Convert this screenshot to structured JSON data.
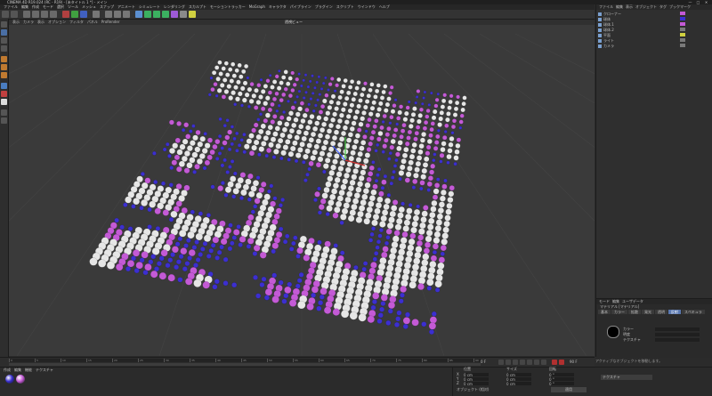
{
  "window": {
    "title": "CINEMA 4D R19.024 (RC - R19) - [未タイトル 1 *] - メイン",
    "controls": [
      "—",
      "□",
      "✕"
    ]
  },
  "menubar": {
    "items": [
      "ファイル",
      "編集",
      "作成",
      "モード",
      "選択",
      "ツール",
      "メッシュ",
      "スナップ",
      "アニメート",
      "シミュレート",
      "レンダリング",
      "スカルプト",
      "モーショントラッカー",
      "MoGraph",
      "キャラクタ",
      "パイプライン",
      "プラグイン",
      "スクリプト",
      "ウインドウ",
      "ヘルプ"
    ]
  },
  "viewport": {
    "menu": [
      "表示",
      "カメラ",
      "表示",
      "オプション",
      "フィルタ",
      "パネル",
      "ProRender"
    ],
    "title": "透視ビュー",
    "colors": {
      "white": "#e6e6e6",
      "violet": "#c45ad6",
      "blue": "#3c2fd0",
      "grid": "#444444"
    }
  },
  "object_manager": {
    "menu": [
      "ファイル",
      "編集",
      "表示",
      "オブジェクト",
      "タグ",
      "ブックマーク"
    ],
    "objects": [
      {
        "name": "クローナー"
      },
      {
        "name": "球体"
      },
      {
        "name": "球体.1"
      },
      {
        "name": "球体.2"
      },
      {
        "name": "平面"
      },
      {
        "name": "ライト"
      },
      {
        "name": "カメラ"
      }
    ]
  },
  "attribute_manager": {
    "menu": [
      "モード",
      "編集",
      "ユーザデータ"
    ],
    "header": "マテリアル [マテリアル]",
    "tabs": [
      "基本",
      "カラー",
      "拡散",
      "発光",
      "透明",
      "反射",
      "スペキュラ"
    ],
    "active_tab": "反射",
    "rows": [
      {
        "label": "カラー"
      },
      {
        "label": "明度"
      },
      {
        "label": "テクスチャ"
      }
    ]
  },
  "timeline": {
    "ticks": [
      "0",
      "5",
      "10",
      "15",
      "20",
      "25",
      "30",
      "35",
      "40",
      "45",
      "50",
      "55",
      "60",
      "65",
      "70",
      "75",
      "80",
      "85",
      "90"
    ],
    "current_frame": "0 F",
    "end_frame": "90 F"
  },
  "material_manager": {
    "menu": [
      "作成",
      "編集",
      "機能",
      "テクスチャ"
    ],
    "materials": [
      {
        "name": "Mat",
        "color": "#3a2fd0"
      },
      {
        "name": "Mat.1",
        "color": "#c45ad6"
      }
    ]
  },
  "coordinates": {
    "headers": [
      "位置",
      "サイズ",
      "回転"
    ],
    "rows": [
      {
        "axis": "X",
        "p": "0 cm",
        "s": "0 cm",
        "r": "0 °"
      },
      {
        "axis": "Y",
        "p": "0 cm",
        "s": "0 cm",
        "r": "0 °"
      },
      {
        "axis": "Z",
        "p": "0 cm",
        "s": "0 cm",
        "r": "0 °"
      }
    ],
    "mode": "オブジェクト (相対)",
    "apply": "適用"
  },
  "status": {
    "message": "アクティブなオブジェクトを移動します。",
    "button": "テクスチャ"
  }
}
